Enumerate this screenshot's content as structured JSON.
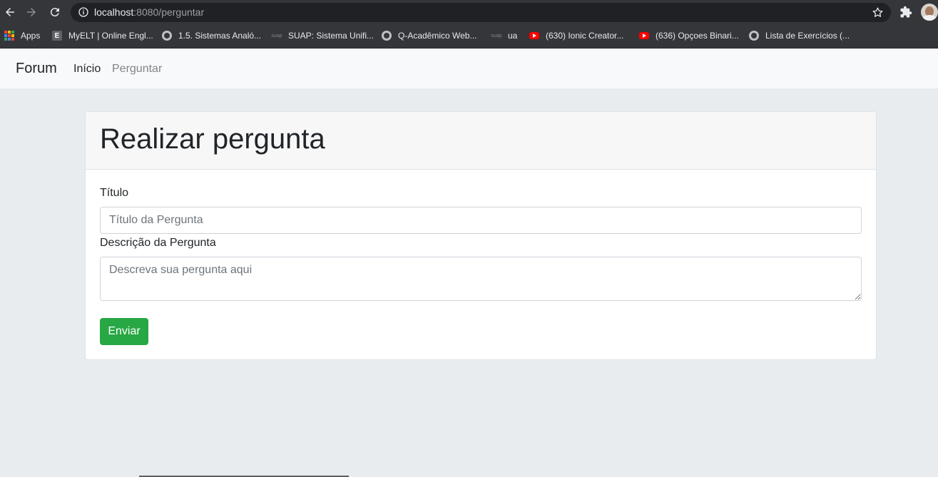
{
  "browser": {
    "url_host": "localhost",
    "url_path": ":8080/perguntar",
    "bookmarks": [
      {
        "label": "Apps",
        "icon": "apps-grid-icon"
      },
      {
        "label": "MyELT | Online Engl...",
        "icon": "e-icon"
      },
      {
        "label": "1.5. Sistemas Analó...",
        "icon": "globe-icon"
      },
      {
        "label": "SUAP: Sistema Unifi...",
        "icon": "suap-icon"
      },
      {
        "label": "Q-Acadêmico Web...",
        "icon": "globe-icon"
      },
      {
        "label": "ua",
        "icon": "suap-icon"
      },
      {
        "label": "(630) Ionic Creator...",
        "icon": "youtube-icon"
      },
      {
        "label": "(636) Opçoes Binari...",
        "icon": "youtube-icon"
      },
      {
        "label": "Lista de Exercícios (...",
        "icon": "globe-icon"
      }
    ],
    "suap_icon_text": "suap"
  },
  "navbar": {
    "brand": "Forum",
    "links": [
      {
        "label": "Início"
      },
      {
        "label": "Perguntar"
      }
    ]
  },
  "card": {
    "title": "Realizar pergunta",
    "title_field": {
      "label": "Título",
      "placeholder": "Título da Pergunta",
      "value": ""
    },
    "description_field": {
      "label": "Descrição da Pergunta",
      "placeholder": "Descreva sua pergunta aqui",
      "value": ""
    },
    "submit_label": "Enviar"
  },
  "colors": {
    "chrome_bg": "#35363a",
    "omnibox_bg": "#202124",
    "navbar_bg": "#f8f9fa",
    "page_bg": "#e9ecef",
    "submit_green": "#28a745"
  }
}
